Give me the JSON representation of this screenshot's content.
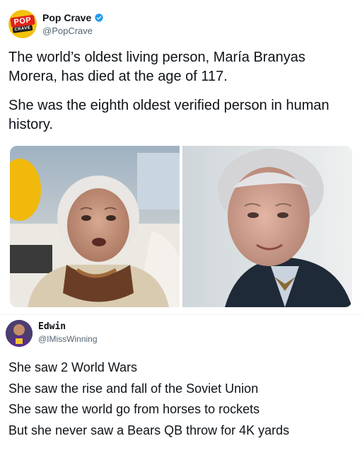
{
  "post": {
    "author_name": "Pop Crave",
    "author_handle": "@PopCrave",
    "avatar_logo_top": "POP",
    "avatar_logo_bottom": "CRAVE",
    "verified_icon": "verified-badge-icon",
    "verified_color": "#1d9bf0",
    "text_line1": "The world’s oldest living person, María Branyas Morera, has died at the age of 117.",
    "text_line2": "She was the eighth oldest verified person in human history.",
    "images": [
      {
        "name": "photo-left",
        "subject": "elderly woman in brown scarf, yellow balloon beside her"
      },
      {
        "name": "photo-right",
        "subject": "elderly woman smiling in dark jacket"
      }
    ]
  },
  "reply": {
    "author_name": "Edwin",
    "author_handle": "@IMissWinning",
    "lines": [
      "She saw 2 World Wars",
      "She saw the rise and fall of the Soviet Union",
      "She saw the world go from horses to rockets",
      "But she never saw a Bears QB throw for 4K yards"
    ]
  },
  "colors": {
    "text": "#0f1419",
    "secondary": "#536471",
    "divider": "#eff3f4",
    "brand_yellow": "#f4c20d",
    "brand_red": "#e2231a"
  }
}
